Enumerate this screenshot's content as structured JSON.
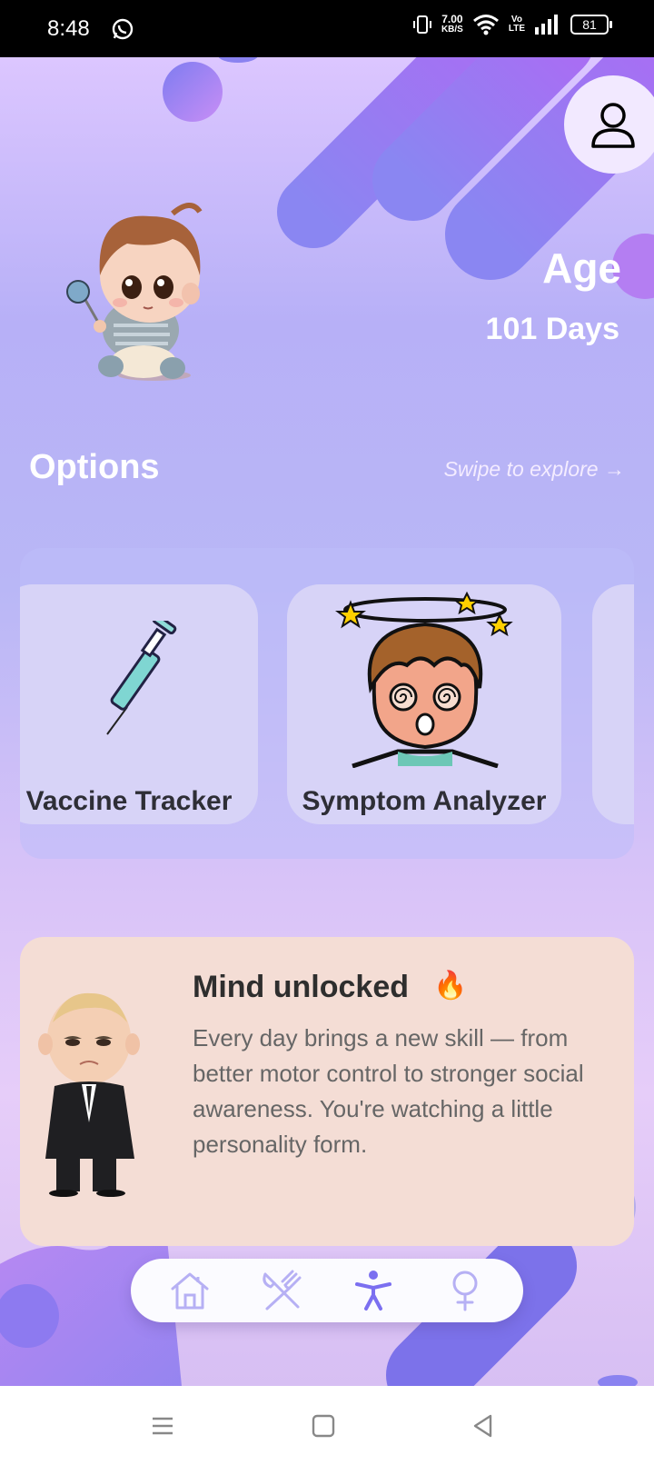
{
  "status_bar": {
    "time": "8:48",
    "net_speed_value": "7.00",
    "net_speed_unit": "KB/S",
    "volte_top": "Vo",
    "volte_bottom": "LTE",
    "battery": "81"
  },
  "header": {
    "age_label": "Age",
    "age_value": "101 Days"
  },
  "options": {
    "title": "Options",
    "swipe_hint": "Swipe to explore →",
    "cards": [
      {
        "label": "Vaccine Tracker",
        "icon": "syringe-icon"
      },
      {
        "label": "Symptom Analyzer",
        "icon": "dizzy-boy-illustration"
      }
    ]
  },
  "insight": {
    "title": "Mind unlocked",
    "emoji": "🔥",
    "body": "Every day brings a new skill — from better motor control to stronger social awareness. You're watching a little personality form."
  },
  "bottom_nav": {
    "items": [
      {
        "icon": "home-icon",
        "active": false
      },
      {
        "icon": "utensils-icon",
        "active": false
      },
      {
        "icon": "activity-person-icon",
        "active": true
      },
      {
        "icon": "female-symbol-icon",
        "active": false
      }
    ]
  },
  "colors": {
    "accent": "#7b6ff0",
    "nav_inactive": "#b6b0f4",
    "card_bg": "#d7d3f7",
    "insight_bg": "#f4ddd5"
  }
}
